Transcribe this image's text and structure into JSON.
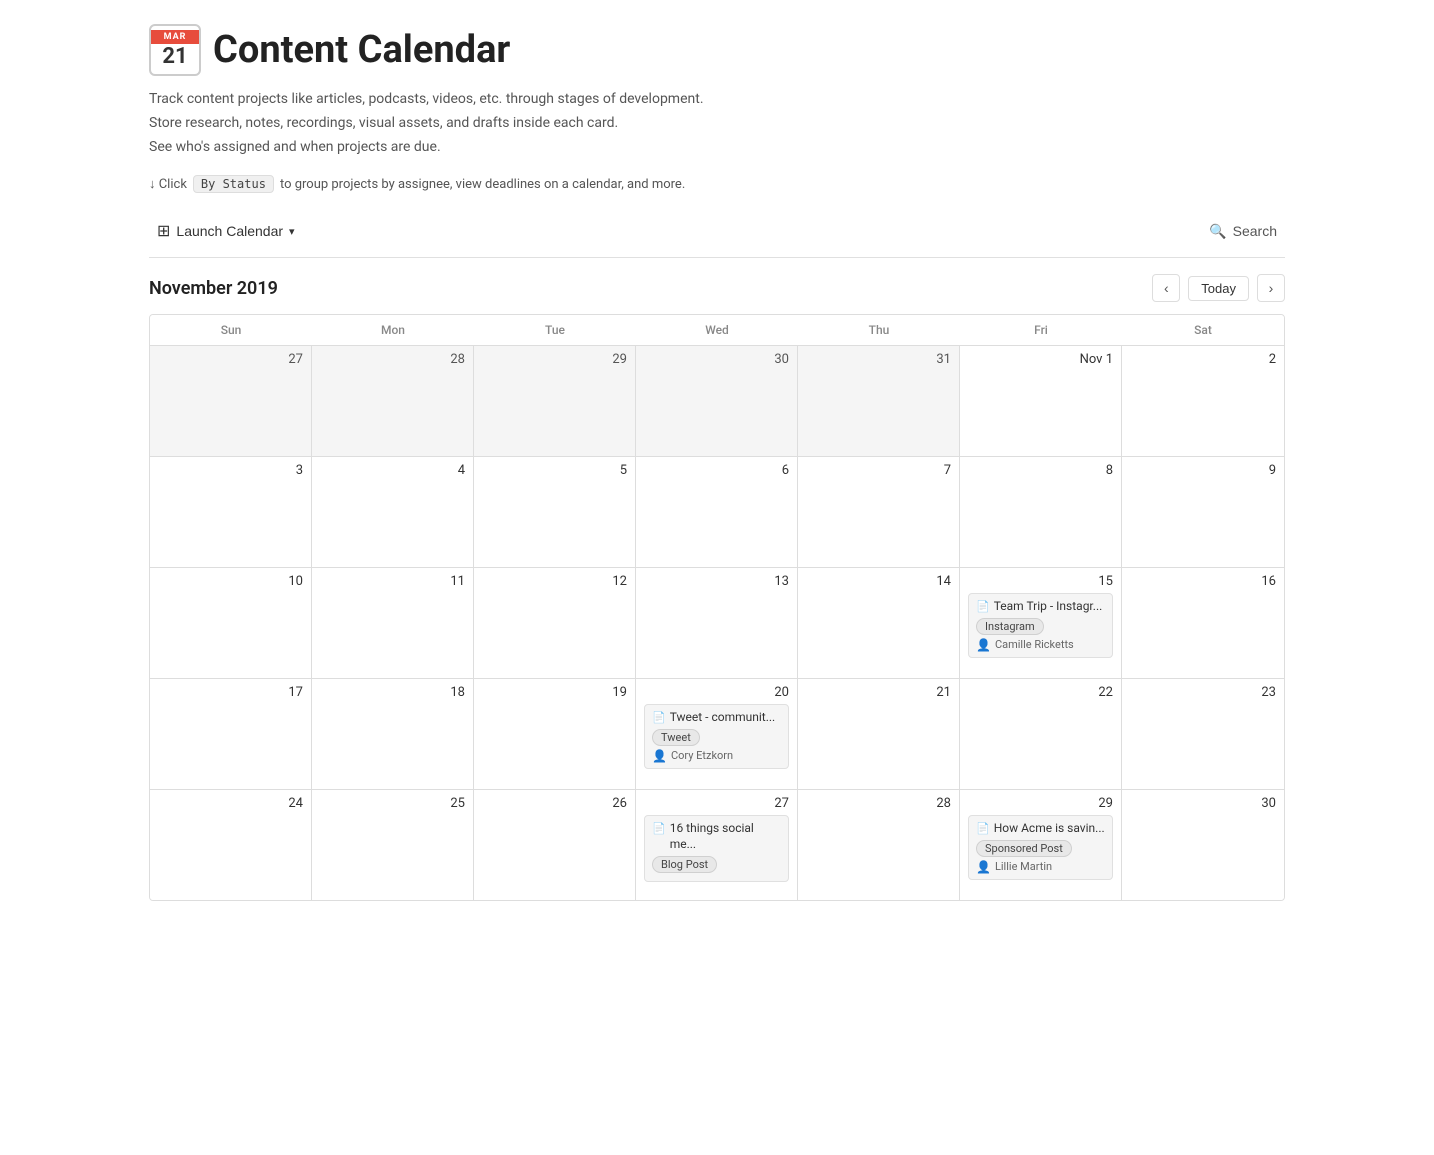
{
  "header": {
    "icon_month": "MAR",
    "icon_day": "21",
    "title": "Content Calendar",
    "description_lines": [
      "Track content projects like articles, podcasts, videos, etc. through stages of development.",
      "Store research, notes, recordings, visual assets, and drafts inside each card.",
      "See who's assigned and when projects are due."
    ],
    "hint_prefix": "↓ Click",
    "hint_badge": "By Status",
    "hint_suffix": "to group projects by assignee, view deadlines on a calendar, and more."
  },
  "toolbar": {
    "launch_label": "Launch Calendar",
    "search_label": "Search"
  },
  "calendar": {
    "month_title": "November 2019",
    "today_label": "Today",
    "nav_prev": "‹",
    "nav_next": "›",
    "day_headers": [
      "Sun",
      "Mon",
      "Tue",
      "Wed",
      "Thu",
      "Fri",
      "Sat"
    ],
    "weeks": [
      {
        "days": [
          {
            "number": "27",
            "outside": true,
            "events": []
          },
          {
            "number": "28",
            "outside": true,
            "events": []
          },
          {
            "number": "29",
            "outside": true,
            "events": []
          },
          {
            "number": "30",
            "outside": true,
            "events": []
          },
          {
            "number": "31",
            "outside": true,
            "events": []
          },
          {
            "number": "Nov 1",
            "outside": false,
            "events": []
          },
          {
            "number": "2",
            "outside": false,
            "events": []
          }
        ]
      },
      {
        "days": [
          {
            "number": "3",
            "outside": false,
            "events": []
          },
          {
            "number": "4",
            "outside": false,
            "events": []
          },
          {
            "number": "5",
            "outside": false,
            "events": []
          },
          {
            "number": "6",
            "outside": false,
            "events": []
          },
          {
            "number": "7",
            "outside": false,
            "events": []
          },
          {
            "number": "8",
            "outside": false,
            "events": []
          },
          {
            "number": "9",
            "outside": false,
            "events": []
          }
        ]
      },
      {
        "days": [
          {
            "number": "10",
            "outside": false,
            "events": []
          },
          {
            "number": "11",
            "outside": false,
            "events": []
          },
          {
            "number": "12",
            "outside": false,
            "events": []
          },
          {
            "number": "13",
            "outside": false,
            "events": []
          },
          {
            "number": "14",
            "outside": false,
            "events": []
          },
          {
            "number": "15",
            "outside": false,
            "events": [
              {
                "title": "Team Trip - Instagr...",
                "tag": "Instagram",
                "assignee": "Camille Ricketts"
              }
            ]
          },
          {
            "number": "16",
            "outside": false,
            "events": []
          }
        ]
      },
      {
        "days": [
          {
            "number": "17",
            "outside": false,
            "events": []
          },
          {
            "number": "18",
            "outside": false,
            "events": []
          },
          {
            "number": "19",
            "outside": false,
            "events": []
          },
          {
            "number": "20",
            "outside": false,
            "events": [
              {
                "title": "Tweet - communit...",
                "tag": "Tweet",
                "assignee": "Cory Etzkorn"
              }
            ]
          },
          {
            "number": "21",
            "outside": false,
            "events": []
          },
          {
            "number": "22",
            "outside": false,
            "events": []
          },
          {
            "number": "23",
            "outside": false,
            "events": []
          }
        ]
      },
      {
        "days": [
          {
            "number": "24",
            "outside": false,
            "events": []
          },
          {
            "number": "25",
            "outside": false,
            "events": []
          },
          {
            "number": "26",
            "outside": false,
            "events": []
          },
          {
            "number": "27",
            "outside": false,
            "events": [
              {
                "title": "16 things social me...",
                "tag": "Blog Post",
                "assignee": null
              }
            ]
          },
          {
            "number": "28",
            "outside": false,
            "events": []
          },
          {
            "number": "29",
            "outside": false,
            "events": [
              {
                "title": "How Acme is savin...",
                "tag": "Sponsored Post",
                "assignee": "Lillie Martin"
              }
            ]
          },
          {
            "number": "30",
            "outside": false,
            "events": []
          }
        ]
      }
    ]
  }
}
